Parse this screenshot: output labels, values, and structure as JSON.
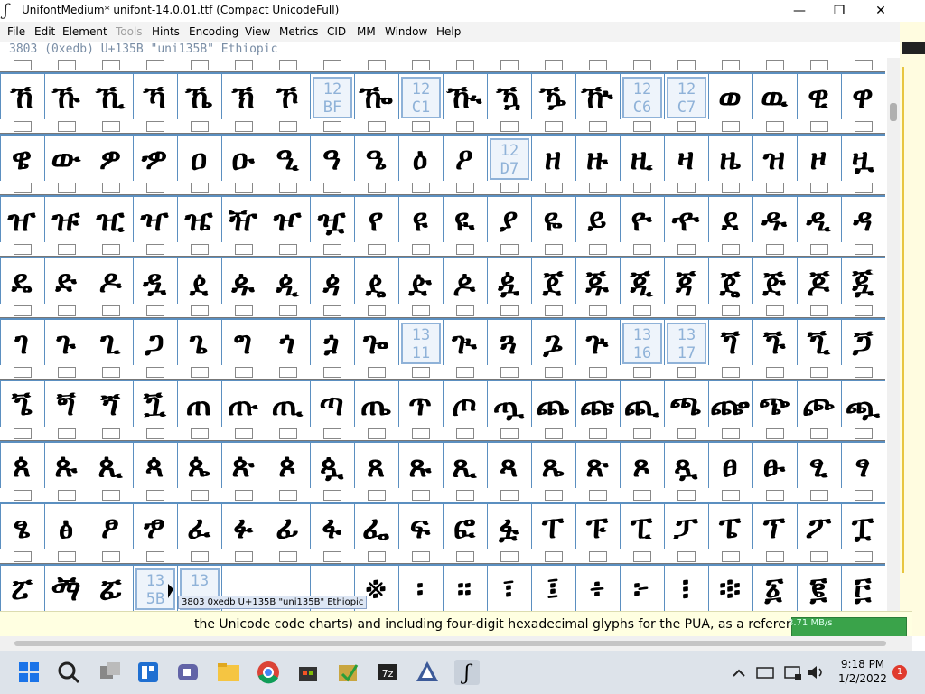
{
  "window": {
    "title": "UnifontMedium*  unifont-14.0.01.ttf (Compact UnicodeFull)",
    "minimize": "—",
    "maximize": "❐",
    "close": "✕"
  },
  "menu": [
    "File",
    "Edit",
    "Element",
    "Tools",
    "Hints",
    "Encoding",
    "View",
    "Metrics",
    "CID",
    "MM",
    "Window",
    "Help"
  ],
  "menu_disabled": [
    "Tools"
  ],
  "info_line": "3803 (0xedb) U+135B \"uni135B\" Ethiopic",
  "glyph_rows": [
    [
      "ኸ",
      "ኹ",
      "ኺ",
      "ኻ",
      "ኼ",
      "ኽ",
      "ኾ",
      "",
      "ዀ",
      "",
      "ዂ",
      "ዃ",
      "ዄ",
      "ዅ",
      "",
      "",
      "ወ",
      "ዉ",
      "ዊ",
      "ዋ"
    ],
    [
      "ዌ",
      "ው",
      "ዎ",
      "ዏ",
      "ዐ",
      "ዑ",
      "ዒ",
      "ዓ",
      "ዔ",
      "ዕ",
      "ዖ",
      "",
      "ዘ",
      "ዙ",
      "ዚ",
      "ዛ",
      "ዜ",
      "ዝ",
      "ዞ",
      "ዟ"
    ],
    [
      "ዠ",
      "ዡ",
      "ዢ",
      "ዣ",
      "ዤ",
      "ዥ",
      "ዦ",
      "ዧ",
      "የ",
      "ዩ",
      "ዪ",
      "ያ",
      "ዬ",
      "ይ",
      "ዮ",
      "ዯ",
      "ደ",
      "ዱ",
      "ዲ",
      "ዳ"
    ],
    [
      "ዴ",
      "ድ",
      "ዶ",
      "ዷ",
      "ዸ",
      "ዹ",
      "ዺ",
      "ዻ",
      "ዼ",
      "ዽ",
      "ዾ",
      "ዿ",
      "ጀ",
      "ጁ",
      "ጂ",
      "ጃ",
      "ጄ",
      "ጅ",
      "ጆ",
      "ጇ"
    ],
    [
      "ገ",
      "ጉ",
      "ጊ",
      "ጋ",
      "ጌ",
      "ግ",
      "ጎ",
      "ጏ",
      "ጐ",
      "",
      "ጒ",
      "ጓ",
      "ጔ",
      "ጕ",
      "",
      "",
      "ጘ",
      "ጙ",
      "ጚ",
      "ጛ"
    ],
    [
      "ጜ",
      "ጝ",
      "ጞ",
      "ጟ",
      "ጠ",
      "ጡ",
      "ጢ",
      "ጣ",
      "ጤ",
      "ጥ",
      "ጦ",
      "ጧ",
      "ጨ",
      "ጩ",
      "ጪ",
      "ጫ",
      "ጬ",
      "ጭ",
      "ጮ",
      "ጯ"
    ],
    [
      "ጰ",
      "ጱ",
      "ጲ",
      "ጳ",
      "ጴ",
      "ጵ",
      "ጶ",
      "ጷ",
      "ጸ",
      "ጹ",
      "ጺ",
      "ጻ",
      "ጼ",
      "ጽ",
      "ጾ",
      "ጿ",
      "ፀ",
      "ፁ",
      "ፂ",
      "ፃ"
    ],
    [
      "ፄ",
      "ፅ",
      "ፆ",
      "ፇ",
      "ፈ",
      "ፉ",
      "ፊ",
      "ፋ",
      "ፌ",
      "ፍ",
      "ፎ",
      "ፏ",
      "ፐ",
      "ፑ",
      "ፒ",
      "ፓ",
      "ፔ",
      "ፕ",
      "ፖ",
      "ፗ"
    ],
    [
      "ፘ",
      "ፙ",
      "ፚ",
      "",
      "",
      "",
      "",
      "",
      "፠",
      "፡",
      "።",
      "፣",
      "፤",
      "፥",
      "፦",
      "፧",
      "፨",
      "፩",
      "፪",
      "፫"
    ]
  ],
  "empty_slots": [
    {
      "row": 0,
      "col": 7,
      "code": [
        "12",
        "BF"
      ]
    },
    {
      "row": 0,
      "col": 9,
      "code": [
        "12",
        "C1"
      ]
    },
    {
      "row": 0,
      "col": 14,
      "code": [
        "12",
        "C6"
      ]
    },
    {
      "row": 0,
      "col": 15,
      "code": [
        "12",
        "C7"
      ]
    },
    {
      "row": 1,
      "col": 11,
      "code": [
        "12",
        "D7"
      ]
    },
    {
      "row": 4,
      "col": 9,
      "code": [
        "13",
        "11"
      ]
    },
    {
      "row": 4,
      "col": 14,
      "code": [
        "13",
        "16"
      ]
    },
    {
      "row": 4,
      "col": 15,
      "code": [
        "13",
        "17"
      ]
    },
    {
      "row": 8,
      "col": 3,
      "code": [
        "13",
        "5B"
      ]
    },
    {
      "row": 8,
      "col": 4,
      "code": [
        "13",
        ""
      ]
    }
  ],
  "tooltip": "3803 0xedb U+135B \"uni135B\" Ethiopic",
  "marquee_text": "the Unicode code charts) and including four-digit hexadecimal glyphs for the PUA, as a reference for",
  "meter_text": "3.71 MB/s",
  "taskbar": {
    "time": "9:18 PM",
    "date": "1/2/2022",
    "notifications": "1"
  }
}
